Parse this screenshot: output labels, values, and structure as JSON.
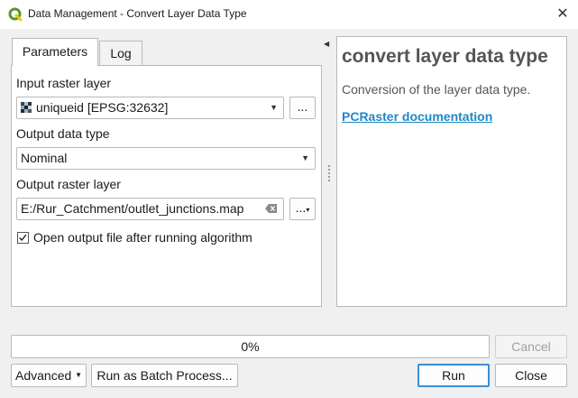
{
  "window": {
    "title": "Data Management - Convert Layer Data Type",
    "close_glyph": "✕"
  },
  "tabs": [
    {
      "label": "Parameters"
    },
    {
      "label": "Log"
    }
  ],
  "params": {
    "input_raster_label": "Input raster layer",
    "input_raster_value": "uniqueid [EPSG:32632]",
    "browse_label": "...",
    "output_type_label": "Output data type",
    "output_type_value": "Nominal",
    "output_raster_label": "Output raster layer",
    "output_raster_value": "E:/Rur_Catchment/outlet_junctions.map",
    "output_browse_label": "...",
    "open_output_label": "Open output file after running algorithm",
    "open_output_checked": true
  },
  "help": {
    "title": "convert layer data type",
    "description": "Conversion of the layer data type.",
    "link": "PCRaster documentation"
  },
  "progress": {
    "text": "0%",
    "value": 0
  },
  "buttons": {
    "cancel": "Cancel",
    "advanced": "Advanced",
    "batch": "Run as Batch Process...",
    "run": "Run",
    "close": "Close"
  },
  "colors": {
    "accent": "#3a8fd6",
    "link": "#1e88c8",
    "qgis_green": "#589632",
    "qgis_yellow": "#f0c419"
  },
  "icons": {
    "app": "qgis-icon",
    "raster": "raster-layer-icon",
    "clear": "clear-text-icon",
    "dropdown": "chevron-down-icon",
    "splitter": "collapse-arrow-icon"
  }
}
